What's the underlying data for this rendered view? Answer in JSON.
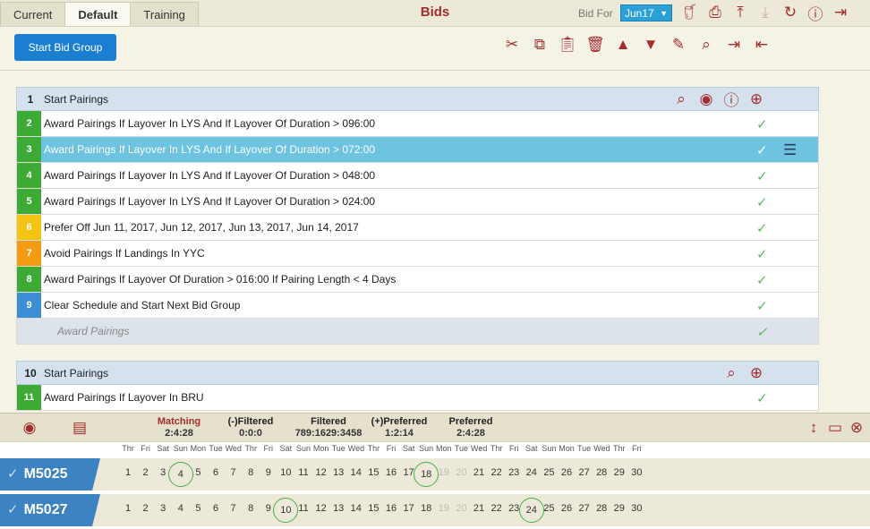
{
  "top": {
    "tabs": [
      "Current",
      "Default",
      "Training"
    ],
    "active_tab": "Default",
    "title": "Bids",
    "bid_for_label": "Bid For",
    "bid_for_value": "Jun17"
  },
  "toolbar": {
    "start_bid_group": "Start Bid Group"
  },
  "group1": {
    "number": "1",
    "name": "Start Pairings",
    "rows": [
      {
        "num": "2",
        "text": "Award Pairings If Layover In LYS And If Layover Of Duration > 096:00",
        "color": "#3daa35"
      },
      {
        "num": "3",
        "text": "Award Pairings If Layover In LYS And If Layover Of Duration > 072:00",
        "color": "#3daa35",
        "selected": true
      },
      {
        "num": "4",
        "text": "Award Pairings If Layover In LYS And If Layover Of Duration > 048:00",
        "color": "#3daa35"
      },
      {
        "num": "5",
        "text": "Award Pairings If Layover In LYS And If Layover Of Duration > 024:00",
        "color": "#3daa35"
      },
      {
        "num": "6",
        "text": "Prefer Off Jun 11, 2017, Jun 12, 2017, Jun 13, 2017, Jun 14, 2017",
        "color": "#f4c414"
      },
      {
        "num": "7",
        "text": "Avoid Pairings If Landings In YYC",
        "color": "#f39c12"
      },
      {
        "num": "8",
        "text": "Award Pairings If Layover Of Duration > 016:00 If Pairing Length < 4 Days",
        "color": "#3daa35"
      },
      {
        "num": "9",
        "text": "Clear Schedule and Start Next Bid Group",
        "color": "#3d8fd4"
      }
    ],
    "footer": "Award Pairings"
  },
  "group2": {
    "number": "10",
    "name": "Start Pairings",
    "rows": [
      {
        "num": "11",
        "text": "Award Pairings If Layover In BRU",
        "color": "#3daa35"
      }
    ]
  },
  "stats": {
    "matching_label": "Matching",
    "matching_value": "2:4:28",
    "filtered_minus_label": "(-)Filtered",
    "filtered_minus_value": "0:0:0",
    "filtered_label": "Filtered",
    "filtered_value": "789:1629:3458",
    "preferred_plus_label": "(+)Preferred",
    "preferred_plus_value": "1:2:14",
    "preferred_label": "Preferred",
    "preferred_value": "2:4:28"
  },
  "weekdays": [
    "Thr",
    "Fri",
    "Sat",
    "Sun",
    "Mon",
    "Tue",
    "Wed",
    "Thr",
    "Fri",
    "Sat",
    "Sun",
    "Mon",
    "Tue",
    "Wed",
    "Thr",
    "Fri",
    "Sat",
    "Sun",
    "Mon",
    "Tue",
    "Wed",
    "Thr",
    "Fri",
    "Sat",
    "Sun",
    "Mon",
    "Tue",
    "Wed",
    "Thr",
    "Fri"
  ],
  "pairings": [
    {
      "id": "M5025",
      "circled": [
        4,
        18
      ],
      "dim": [
        19,
        20
      ]
    },
    {
      "id": "M5027",
      "circled": [
        10,
        24
      ],
      "dim": [
        19,
        20
      ]
    }
  ],
  "icons": {
    "top": [
      "cup-icon",
      "print-icon",
      "upload-icon",
      "download-icon",
      "refresh-icon",
      "help-icon",
      "logout-icon"
    ],
    "tools": [
      "cut-icon",
      "copy-icon",
      "paste-icon",
      "delete-icon",
      "move-up-icon",
      "move-down-icon",
      "edit-icon",
      "search-icon",
      "indent-icon",
      "outdent-icon"
    ]
  }
}
